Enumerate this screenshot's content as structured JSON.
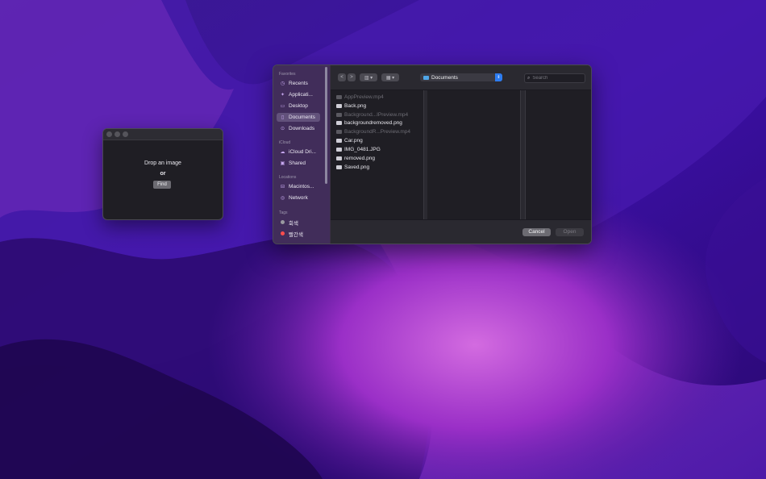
{
  "app": {
    "drop_label": "Drop an image",
    "or_label": "or",
    "find_label": "Find"
  },
  "panel": {
    "sidebar": {
      "sections": [
        {
          "title": "Favorites",
          "items": [
            {
              "label": "Recents",
              "icon": "clock-icon"
            },
            {
              "label": "Applicati...",
              "icon": "applications-icon"
            },
            {
              "label": "Desktop",
              "icon": "desktop-icon"
            },
            {
              "label": "Documents",
              "icon": "document-icon",
              "active": true
            },
            {
              "label": "Downloads",
              "icon": "download-icon"
            }
          ]
        },
        {
          "title": "iCloud",
          "items": [
            {
              "label": "iCloud Dri...",
              "icon": "cloud-icon"
            },
            {
              "label": "Shared",
              "icon": "shared-folder-icon"
            }
          ]
        },
        {
          "title": "Locations",
          "items": [
            {
              "label": "Macintos...",
              "icon": "disk-icon"
            },
            {
              "label": "Network",
              "icon": "globe-icon"
            }
          ]
        },
        {
          "title": "Tags",
          "items": [
            {
              "label": "회색",
              "color": "#9a99a0"
            },
            {
              "label": "빨간색",
              "color": "#ff4d4d"
            }
          ]
        }
      ]
    },
    "toolbar": {
      "back": "<",
      "forward": ">",
      "view_icon": "columns-view-icon",
      "group_icon": "grid-icon",
      "path_label": "Documents",
      "search_placeholder": "Search"
    },
    "files": [
      {
        "name": "AppPreview.mp4",
        "dim": true
      },
      {
        "name": "Back.png",
        "dim": false
      },
      {
        "name": "Background...IPreview.mp4",
        "dim": true
      },
      {
        "name": "backgroundremoved.png",
        "dim": false
      },
      {
        "name": "BackgroundR...Preview.mp4",
        "dim": true
      },
      {
        "name": "Car.png",
        "dim": false
      },
      {
        "name": "IMG_0481.JPG",
        "dim": false
      },
      {
        "name": "removed.png",
        "dim": false
      },
      {
        "name": "Saved.png",
        "dim": false
      }
    ],
    "buttons": {
      "cancel": "Cancel",
      "open": "Open"
    }
  },
  "colors": {
    "accent": "#2d7cf0",
    "wallpaper_base": "#2a0f6b"
  }
}
